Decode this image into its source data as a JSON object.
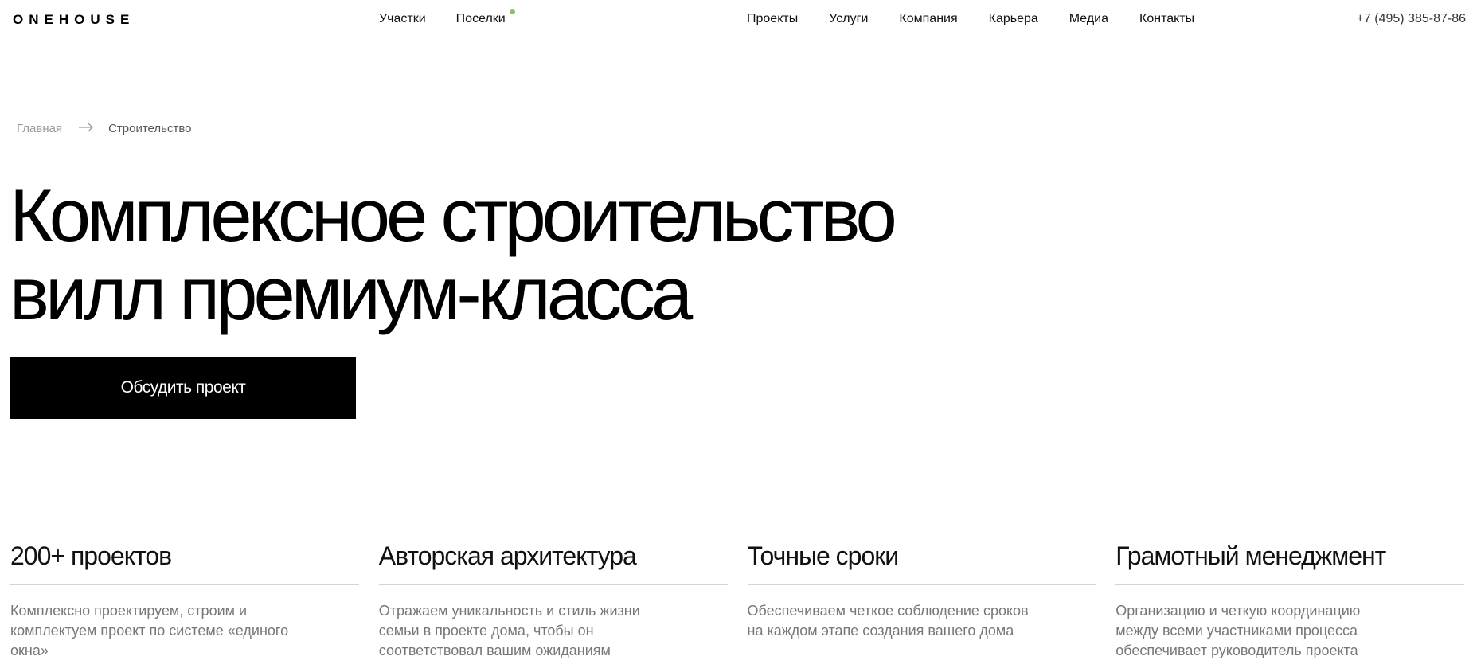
{
  "header": {
    "logo": "ONEHOUSE",
    "nav_left": [
      {
        "label": "Участки"
      },
      {
        "label": "Поселки"
      }
    ],
    "nav_right": [
      {
        "label": "Проекты"
      },
      {
        "label": "Услуги"
      },
      {
        "label": "Компания"
      },
      {
        "label": "Карьера"
      },
      {
        "label": "Медиа"
      },
      {
        "label": "Контакты"
      }
    ],
    "phone": "+7 (495) 385-87-86",
    "indicator_color": "#8cbf6a"
  },
  "breadcrumb": {
    "home": "Главная",
    "current": "Строительство"
  },
  "hero": {
    "title_line1": "Комплексное строительство",
    "title_line2": "вилл премиум-класса",
    "cta_label": "Обсудить проект"
  },
  "features": [
    {
      "title": "200+ проектов",
      "text": "Комплексно проектируем, строим и комплектуем проект по системе «единого окна»"
    },
    {
      "title": "Авторская архитектура",
      "text": "Отражаем уникальность и стиль жизни семьи в проекте дома, чтобы он соответствовал вашим ожиданиям"
    },
    {
      "title": "Точные сроки",
      "text": "Обеспечиваем четкое соблюдение сроков на каждом этапе создания вашего дома"
    },
    {
      "title": "Грамотный менеджмент",
      "text": "Организацию и четкую координацию между всеми участниками процесса обеспечивает руководитель проекта"
    }
  ]
}
